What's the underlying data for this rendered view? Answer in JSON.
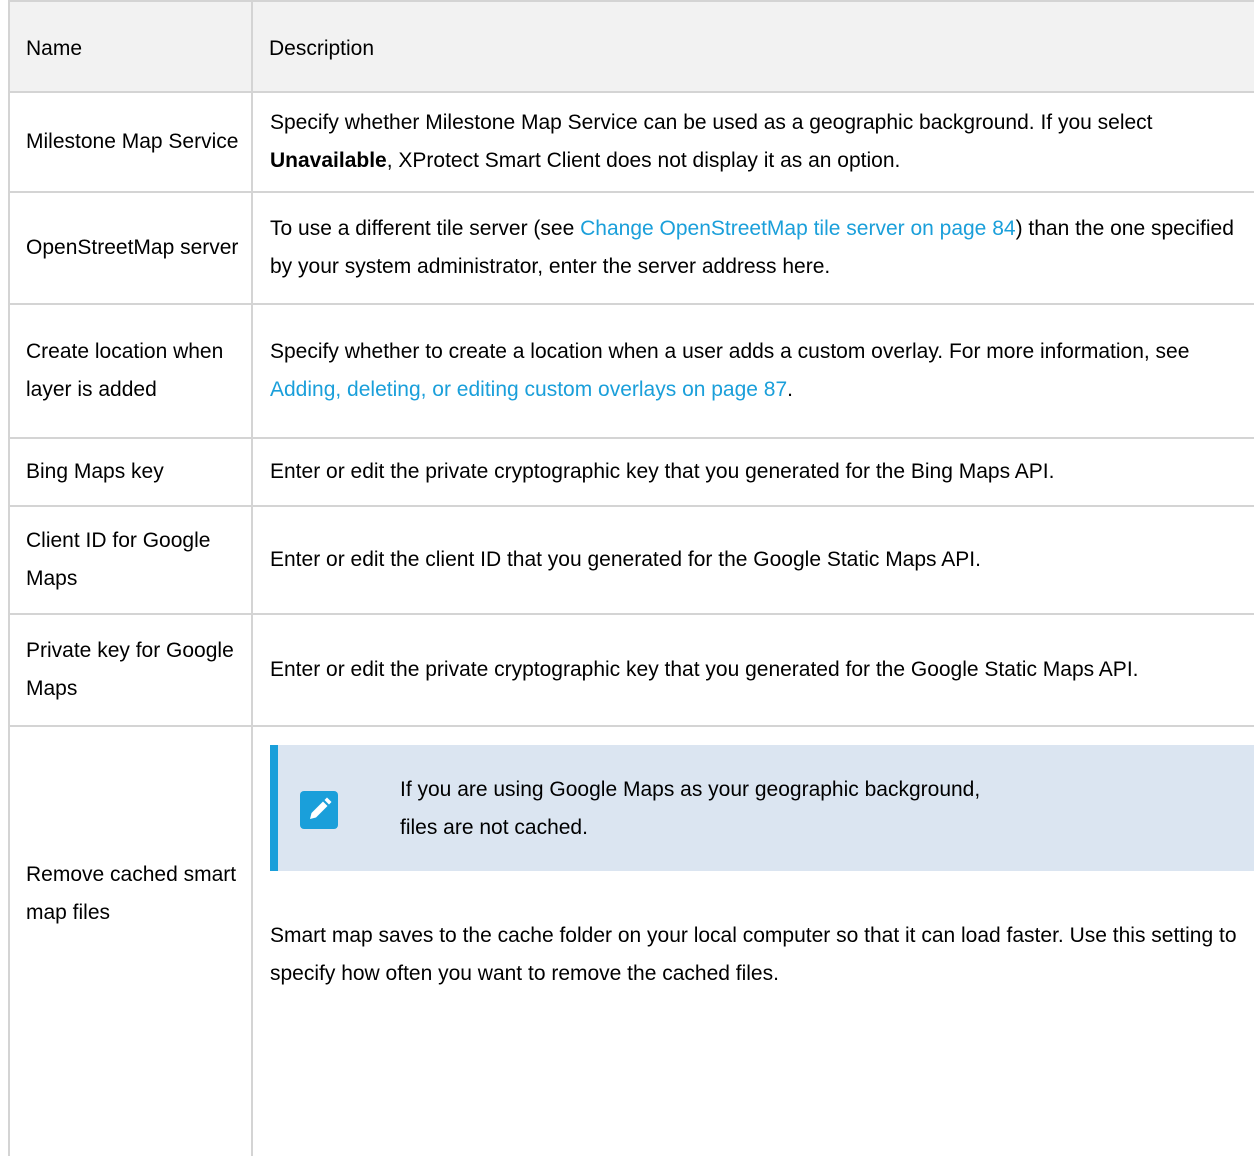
{
  "header": {
    "name": "Name",
    "description": "Description"
  },
  "rows": [
    {
      "name": "Milestone Map Service",
      "desc_pre": "Specify whether Milestone Map Service can be used as a geographic background. If you select ",
      "desc_bold": "Unavailable",
      "desc_post": ", XProtect Smart Client does not display it as an option."
    },
    {
      "name": "OpenStreetMap server",
      "desc_pre": "To use a different tile server (see ",
      "desc_link": "Change OpenStreetMap tile server on page 84",
      "desc_post": ") than the one specified by your system administrator, enter the server address here."
    },
    {
      "name": "Create location when layer is added",
      "desc_pre": "Specify whether to create a location when a user adds a custom overlay. For more information, see ",
      "desc_link": "Adding, deleting, or editing custom overlays on page 87",
      "desc_post": "."
    },
    {
      "name": "Bing Maps key",
      "desc": "Enter or edit the private cryptographic key that you generated for the Bing Maps API."
    },
    {
      "name": "Client ID for Google Maps",
      "desc": "Enter or edit the client ID that you generated for the Google Static Maps API."
    },
    {
      "name": "Private key for Google Maps",
      "desc": "Enter or edit the private cryptographic key that you generated for the Google Static Maps API."
    },
    {
      "name": "Remove cached smart map files",
      "note_line1": "If you are using Google Maps as your geographic background,",
      "note_line2": "files are not cached.",
      "note_icon": "pencil-note-icon",
      "desc": "Smart map saves to the cache folder on your local computer so that it can load faster. Use this setting to specify how often you want to remove the cached files."
    }
  ],
  "colors": {
    "link": "#1a9fda",
    "note_bg": "#dbe5f1",
    "note_bar": "#1a9fda",
    "border": "#d4d4d4",
    "header_bg": "#f2f2f2"
  }
}
